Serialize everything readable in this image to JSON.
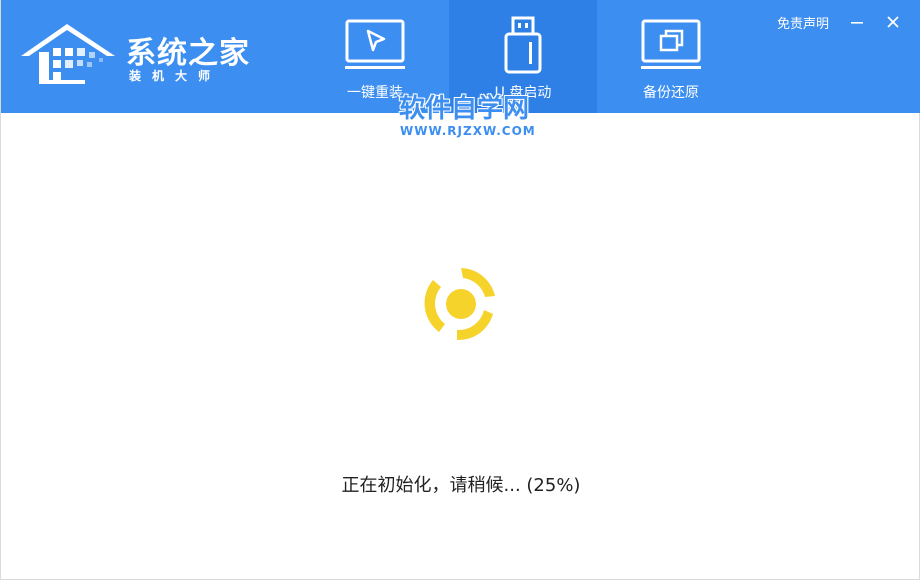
{
  "header": {
    "brand": {
      "title": "系统之家",
      "subtitle": "装机大师",
      "logo_icon": "house-logo-icon"
    },
    "tabs": [
      {
        "label": "一键重装",
        "icon": "cursor-monitor-icon",
        "active": false
      },
      {
        "label": "U 盘启动",
        "icon": "usb-drive-icon",
        "active": true
      },
      {
        "label": "备份还原",
        "icon": "copy-monitor-icon",
        "active": false
      }
    ],
    "disclaimer": "免责声明",
    "minimize_glyph": "—",
    "close_glyph": "✕"
  },
  "watermark": {
    "title": "软件自学网",
    "url": "WWW.RJZXW.COM"
  },
  "main": {
    "status_text": "正在初始化，请稍候... (25%)",
    "progress_percent": 25
  },
  "colors": {
    "header_bg": "#3c8ef0",
    "active_tab_bg": "#2f80e6",
    "spinner": "#f6d32b",
    "status_text": "#222222"
  }
}
